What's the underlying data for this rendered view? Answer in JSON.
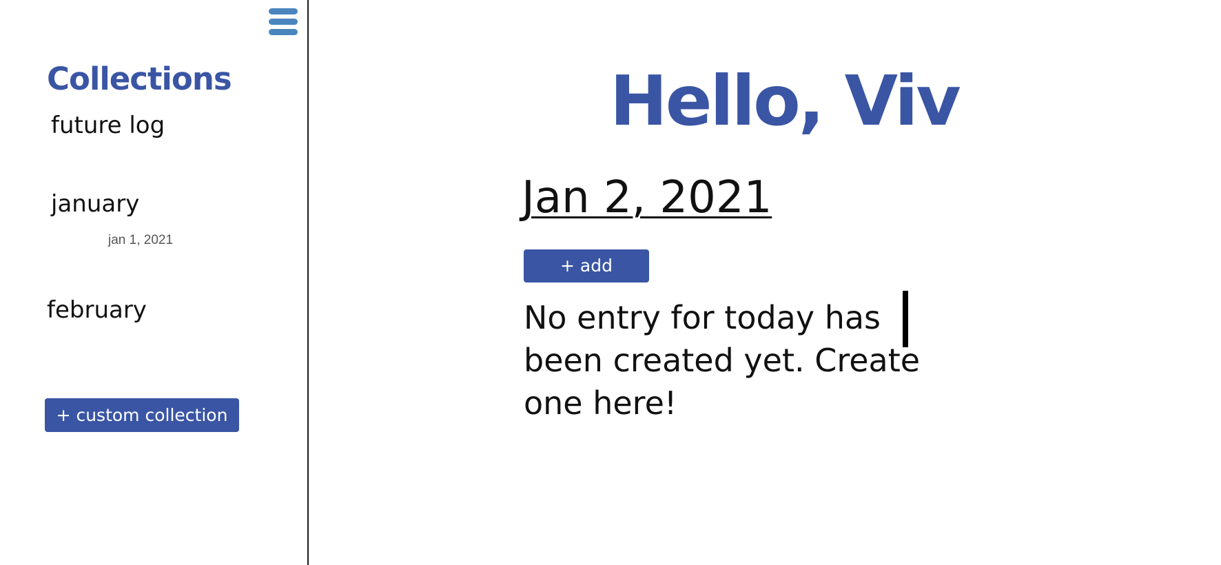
{
  "sidebar": {
    "title": "Collections",
    "menu_icon": "hamburger-menu-icon",
    "items": [
      {
        "label": "future log"
      },
      {
        "label": "january",
        "entries": [
          "jan 1, 2021"
        ]
      },
      {
        "label": "february"
      }
    ],
    "custom_collection_label": "+ custom collection"
  },
  "main": {
    "greeting": "Hello, Viv",
    "date": "Jan 2, 2021",
    "add_label": "+ add",
    "empty_message": "No entry for today has been created yet. Create one here!"
  },
  "colors": {
    "accent": "#3a55a4",
    "menu_icon": "#4a86bd",
    "text": "#111111",
    "muted": "#555555",
    "background": "#ffffff"
  }
}
